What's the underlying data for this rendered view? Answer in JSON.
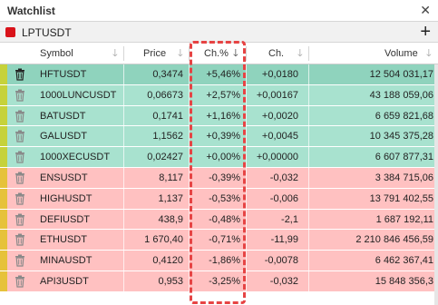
{
  "window": {
    "title": "Watchlist",
    "close_icon": "close-icon"
  },
  "list": {
    "name": "LPTUSDT",
    "color": "#d9131a",
    "add_icon": "plus-icon"
  },
  "columns": [
    {
      "label": "Symbol"
    },
    {
      "label": "Price"
    },
    {
      "label": "Ch.%"
    },
    {
      "label": "Ch."
    },
    {
      "label": "Volume"
    }
  ],
  "sort": {
    "column": "Ch.%",
    "direction": "descending"
  },
  "colors": {
    "selected_row": "#8fd3bd",
    "positive_row": "#a8e2cf",
    "negative_row": "#ffc1c1",
    "marker_positive": "#c6d23a",
    "marker_negative": "#e6c23a",
    "highlight": "#e64444"
  },
  "rows": [
    {
      "symbol": "HFTUSDT",
      "price": "0,3474",
      "change_pct": "+5,46%",
      "change": "+0,0180",
      "volume": "12 504 031,17",
      "direction": "up",
      "selected": true
    },
    {
      "symbol": "1000LUNCUSDT",
      "price": "0,06673",
      "change_pct": "+2,57%",
      "change": "+0,00167",
      "volume": "43 188 059,06",
      "direction": "up"
    },
    {
      "symbol": "BATUSDT",
      "price": "0,1741",
      "change_pct": "+1,16%",
      "change": "+0,0020",
      "volume": "6 659 821,68",
      "direction": "up"
    },
    {
      "symbol": "GALUSDT",
      "price": "1,1562",
      "change_pct": "+0,39%",
      "change": "+0,0045",
      "volume": "10 345 375,28",
      "direction": "up"
    },
    {
      "symbol": "1000XECUSDT",
      "price": "0,02427",
      "change_pct": "+0,00%",
      "change": "+0,00000",
      "volume": "6 607 877,31",
      "direction": "up"
    },
    {
      "symbol": "ENSUSDT",
      "price": "8,117",
      "change_pct": "-0,39%",
      "change": "-0,032",
      "volume": "3 384 715,06",
      "direction": "down"
    },
    {
      "symbol": "HIGHUSDT",
      "price": "1,137",
      "change_pct": "-0,53%",
      "change": "-0,006",
      "volume": "13 791 402,55",
      "direction": "down"
    },
    {
      "symbol": "DEFIUSDT",
      "price": "438,9",
      "change_pct": "-0,48%",
      "change": "-2,1",
      "volume": "1 687 192,11",
      "direction": "down"
    },
    {
      "symbol": "ETHUSDT",
      "price": "1 670,40",
      "change_pct": "-0,71%",
      "change": "-11,99",
      "volume": "2 210 846 456,59",
      "direction": "down"
    },
    {
      "symbol": "MINAUSDT",
      "price": "0,4120",
      "change_pct": "-1,86%",
      "change": "-0,0078",
      "volume": "6 462 367,41",
      "direction": "down"
    },
    {
      "symbol": "API3USDT",
      "price": "0,953",
      "change_pct": "-3,25%",
      "change": "-0,032",
      "volume": "15 848 356,3",
      "direction": "down"
    }
  ]
}
